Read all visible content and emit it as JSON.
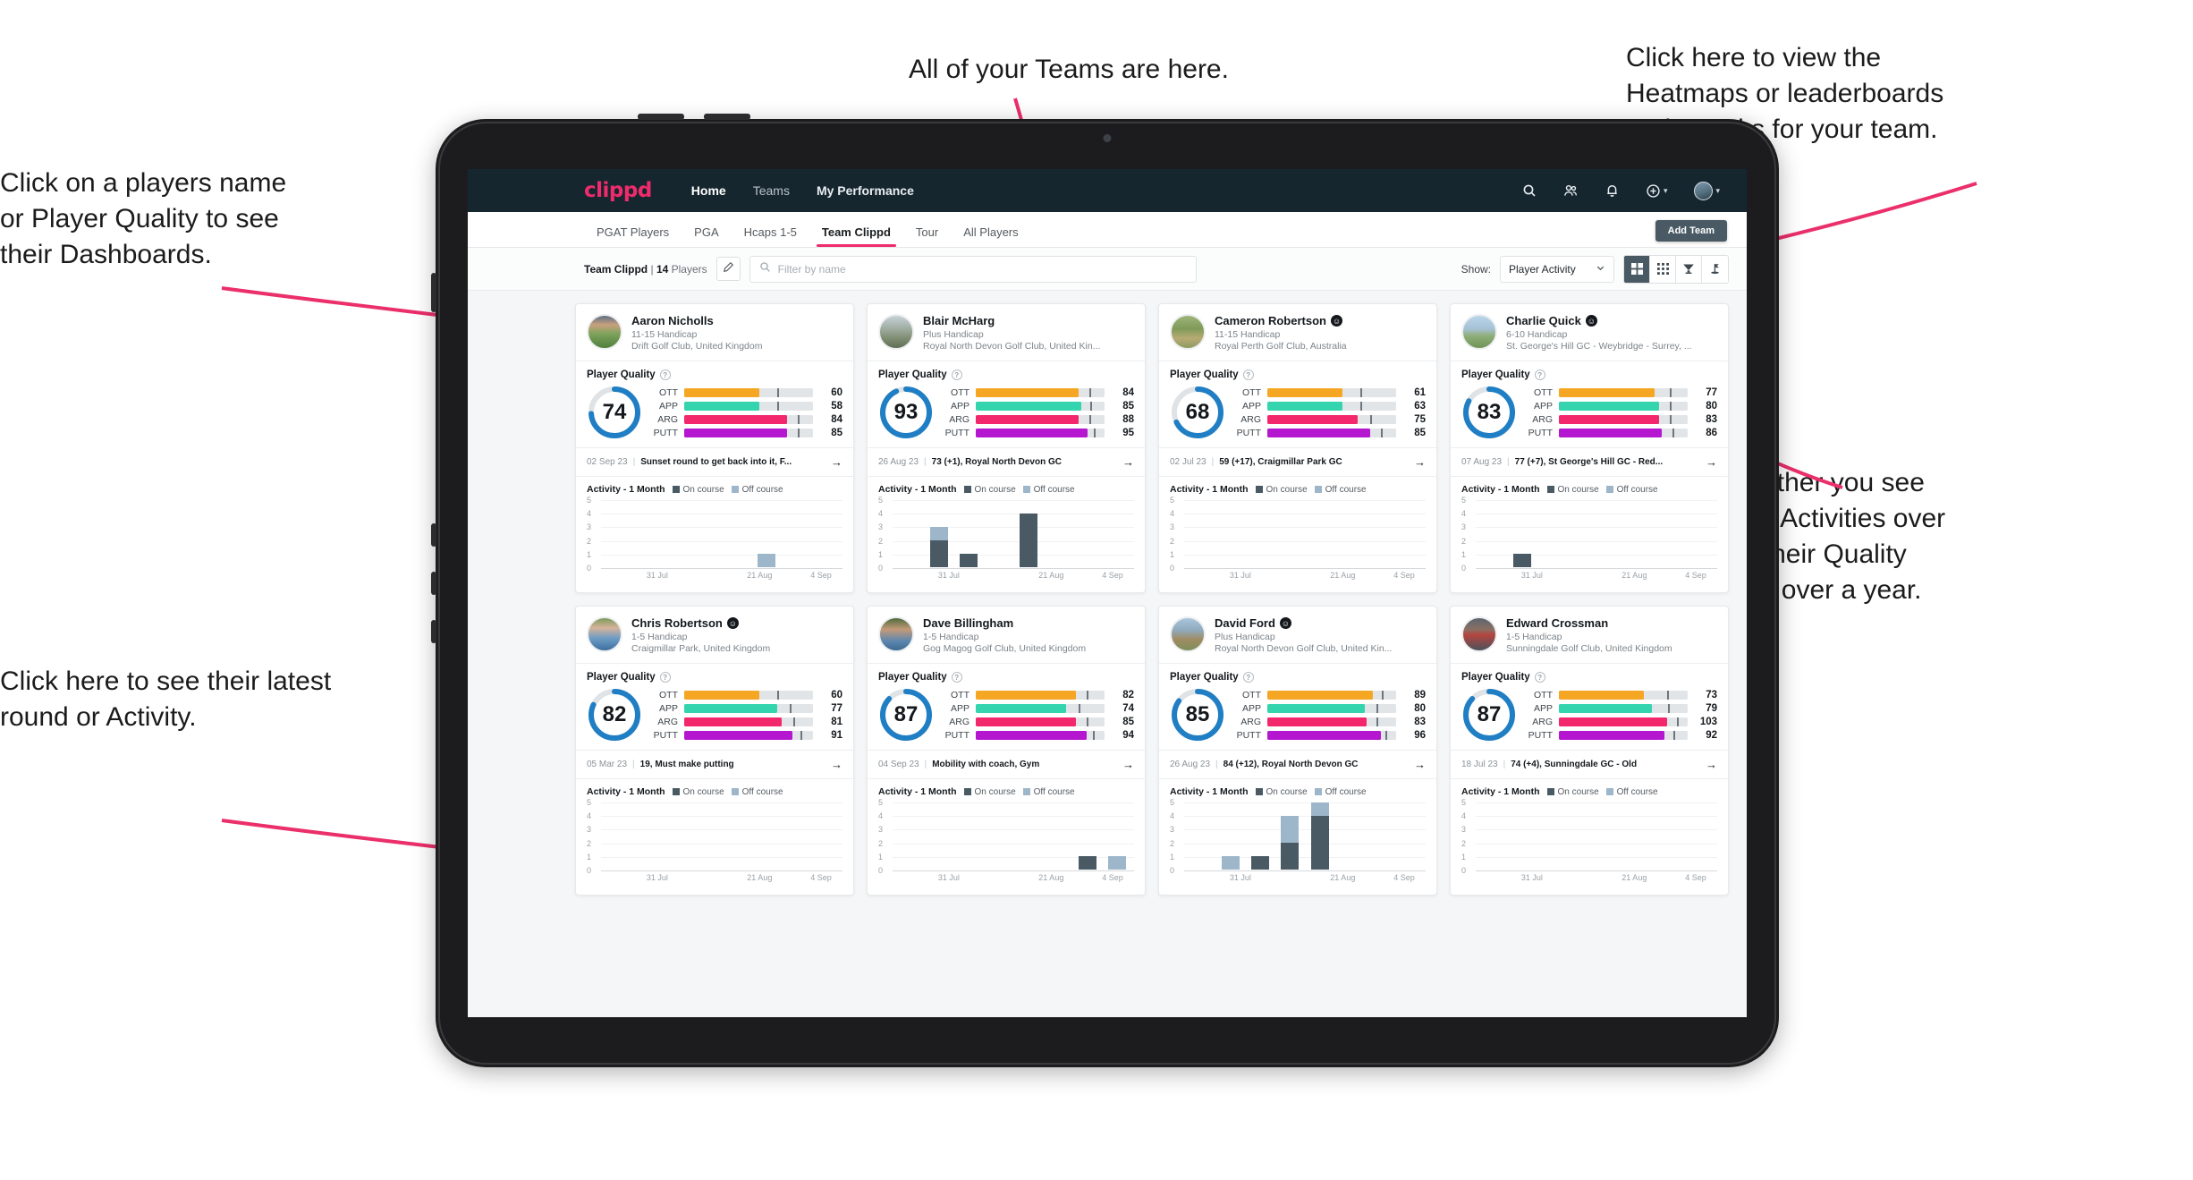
{
  "annotations": [
    {
      "id": "teams",
      "text": "All of your Teams are here."
    },
    {
      "id": "heatmaps",
      "text": "Click here to view the\nHeatmaps or leaderboards\nand streaks for your team."
    },
    {
      "id": "dashboards",
      "text": "Click on a players name\nor Player Quality to see\ntheir Dashboards."
    },
    {
      "id": "activity-toggle",
      "text": "Choose whether you see\nyour players Activities over\na month or their Quality\nScore Trend over a year."
    },
    {
      "id": "latest-round",
      "text": "Click here to see their latest\nround or Activity."
    }
  ],
  "navbar": {
    "brand": "clippd",
    "links": [
      {
        "label": "Home",
        "active": true
      },
      {
        "label": "Teams",
        "active": false
      },
      {
        "label": "My Performance",
        "active": false
      }
    ],
    "icons": [
      "search-icon",
      "people-icon",
      "bell-icon",
      "plus-circle-icon",
      "avatar"
    ]
  },
  "tabs": [
    {
      "label": "PGAT Players",
      "active": false
    },
    {
      "label": "PGA",
      "active": false
    },
    {
      "label": "Hcaps 1-5",
      "active": false
    },
    {
      "label": "Team Clippd",
      "active": true
    },
    {
      "label": "Tour",
      "active": false
    },
    {
      "label": "All Players",
      "active": false
    }
  ],
  "add_team_label": "Add Team",
  "filterbar": {
    "team_name": "Team Clippd",
    "separator": "|",
    "player_count": "14",
    "players_word": "Players",
    "edit_icon": "pencil-icon",
    "search_placeholder": "Filter by name",
    "show_label": "Show:",
    "show_value": "Player Activity",
    "views": [
      {
        "name": "grid-large-view",
        "active": true
      },
      {
        "name": "grid-small-view",
        "active": false
      },
      {
        "name": "trophy-leaderboard-view",
        "active": false
      },
      {
        "name": "flag-course-view",
        "active": false
      }
    ]
  },
  "labels": {
    "player_quality": "Player Quality",
    "activity_title": "Activity - 1 Month",
    "legend_on": "On course",
    "legend_off": "Off course",
    "verified_badge": "☺"
  },
  "colors": {
    "brand_pink": "#ef2b6b",
    "navbar": "#16262f",
    "ring": "#1f7ec4",
    "ott": "#f5a623",
    "app": "#34d5ae",
    "arg": "#f2276c",
    "putt": "#b516cf",
    "on_course": "#4a5a64",
    "off_course": "#9db6ca"
  },
  "chart_data": {
    "type": "bar",
    "title": "Activity - 1 Month",
    "xlabel": "",
    "ylabel": "",
    "ylim": [
      0,
      5
    ],
    "yticks": [
      5,
      4,
      3,
      2,
      1,
      0
    ],
    "xticks": [
      "31 Jul",
      "21 Aug",
      "4 Sep"
    ],
    "legend": [
      "On course",
      "Off course"
    ],
    "legend_position": "top",
    "grid": true,
    "charts": [
      {
        "player": "Aaron Nicholls",
        "on_course": [
          0,
          0,
          0,
          0,
          0,
          0,
          0,
          0
        ],
        "off_course": [
          0,
          0,
          0,
          0,
          0,
          1,
          0,
          0
        ]
      },
      {
        "player": "Blair McHarg",
        "on_course": [
          0,
          2,
          1,
          0,
          4,
          0,
          0,
          0
        ],
        "off_course": [
          0,
          1,
          0,
          0,
          0,
          0,
          0,
          0
        ]
      },
      {
        "player": "Cameron Robertson",
        "on_course": [
          0,
          0,
          0,
          0,
          0,
          0,
          0,
          0
        ],
        "off_course": [
          0,
          0,
          0,
          0,
          0,
          0,
          0,
          0
        ]
      },
      {
        "player": "Charlie Quick",
        "on_course": [
          0,
          1,
          0,
          0,
          0,
          0,
          0,
          0
        ],
        "off_course": [
          0,
          0,
          0,
          0,
          0,
          0,
          0,
          0
        ]
      },
      {
        "player": "Chris Robertson",
        "on_course": [
          0,
          0,
          0,
          0,
          0,
          0,
          0,
          0
        ],
        "off_course": [
          0,
          0,
          0,
          0,
          0,
          0,
          0,
          0
        ]
      },
      {
        "player": "Dave Billingham",
        "on_course": [
          0,
          0,
          0,
          0,
          0,
          0,
          1,
          0
        ],
        "off_course": [
          0,
          0,
          0,
          0,
          0,
          0,
          0,
          1
        ]
      },
      {
        "player": "David Ford",
        "on_course": [
          0,
          0,
          1,
          2,
          4,
          0,
          0,
          0
        ],
        "off_course": [
          0,
          1,
          0,
          2,
          1,
          0,
          0,
          0
        ]
      },
      {
        "player": "Edward Crossman",
        "on_course": [
          0,
          0,
          0,
          0,
          0,
          0,
          0,
          0
        ],
        "off_course": [
          0,
          0,
          0,
          0,
          0,
          0,
          0,
          0
        ]
      }
    ]
  },
  "players": [
    {
      "name": "Aaron Nicholls",
      "verified": false,
      "handicap": "11-15 Handicap",
      "club": "Drift Golf Club, United Kingdom",
      "quality": 74,
      "metrics": [
        {
          "label": "OTT",
          "value": 60,
          "fill": 58,
          "tick": 72
        },
        {
          "label": "APP",
          "value": 58,
          "fill": 58,
          "tick": 72
        },
        {
          "label": "ARG",
          "value": 84,
          "fill": 80,
          "tick": 88
        },
        {
          "label": "PUTT",
          "value": 85,
          "fill": 80,
          "tick": 88
        }
      ],
      "round_date": "02 Sep 23",
      "round_text": "Sunset round to get back into it, F...",
      "avatar_css": "linear-gradient(180deg,#5d6f86 0%,#c9a07e 28%,#7fa35c 55%,#4f7f3d 100%)"
    },
    {
      "name": "Blair McHarg",
      "verified": false,
      "handicap": "Plus Handicap",
      "club": "Royal North Devon Golf Club, United Kin...",
      "quality": 93,
      "metrics": [
        {
          "label": "OTT",
          "value": 84,
          "fill": 80,
          "tick": 88
        },
        {
          "label": "APP",
          "value": 85,
          "fill": 82,
          "tick": 89
        },
        {
          "label": "ARG",
          "value": 88,
          "fill": 80,
          "tick": 88
        },
        {
          "label": "PUTT",
          "value": 95,
          "fill": 87,
          "tick": 92
        }
      ],
      "round_date": "26 Aug 23",
      "round_text": "73 (+1), Royal North Devon GC",
      "avatar_css": "linear-gradient(180deg,#c7d2d8 0%,#9aa89a 45%,#7f8d72 70%,#5f6d55 100%)"
    },
    {
      "name": "Cameron Robertson",
      "verified": true,
      "handicap": "11-15 Handicap",
      "club": "Royal Perth Golf Club, Australia",
      "quality": 68,
      "metrics": [
        {
          "label": "OTT",
          "value": 61,
          "fill": 58,
          "tick": 72
        },
        {
          "label": "APP",
          "value": 63,
          "fill": 58,
          "tick": 72
        },
        {
          "label": "ARG",
          "value": 75,
          "fill": 70,
          "tick": 80
        },
        {
          "label": "PUTT",
          "value": 85,
          "fill": 80,
          "tick": 88
        }
      ],
      "round_date": "02 Jul 23",
      "round_text": "59 (+17), Craigmillar Park GC",
      "avatar_css": "linear-gradient(180deg,#9db57b 0%,#7f9a58 40%,#b7ab74 70%,#8e9a63 100%)"
    },
    {
      "name": "Charlie Quick",
      "verified": true,
      "handicap": "6-10 Handicap",
      "club": "St. George's Hill GC - Weybridge - Surrey, ...",
      "quality": 83,
      "metrics": [
        {
          "label": "OTT",
          "value": 77,
          "fill": 74,
          "tick": 86
        },
        {
          "label": "APP",
          "value": 80,
          "fill": 78,
          "tick": 86
        },
        {
          "label": "ARG",
          "value": 83,
          "fill": 78,
          "tick": 86
        },
        {
          "label": "PUTT",
          "value": 86,
          "fill": 80,
          "tick": 88
        }
      ],
      "round_date": "07 Aug 23",
      "round_text": "77 (+7), St George's Hill GC - Red...",
      "avatar_css": "linear-gradient(180deg,#b9d5ea 0%,#a7c2d6 40%,#8fae79 62%,#6f9456 100%)"
    },
    {
      "name": "Chris Robertson",
      "verified": true,
      "handicap": "1-5 Handicap",
      "club": "Craigmillar Park, United Kingdom",
      "quality": 82,
      "metrics": [
        {
          "label": "OTT",
          "value": 60,
          "fill": 58,
          "tick": 72
        },
        {
          "label": "APP",
          "value": 77,
          "fill": 72,
          "tick": 82
        },
        {
          "label": "ARG",
          "value": 81,
          "fill": 76,
          "tick": 85
        },
        {
          "label": "PUTT",
          "value": 91,
          "fill": 84,
          "tick": 90
        }
      ],
      "round_date": "05 Mar 23",
      "round_text": "19, Must make putting",
      "avatar_css": "linear-gradient(180deg,#7c9a5c 0%,#d7b49a 30%,#6e9cc4 62%,#3d6f9e 100%)"
    },
    {
      "name": "Dave Billingham",
      "verified": false,
      "handicap": "1-5 Handicap",
      "club": "Gog Magog Golf Club, United Kingdom",
      "quality": 87,
      "metrics": [
        {
          "label": "OTT",
          "value": 82,
          "fill": 78,
          "tick": 86
        },
        {
          "label": "APP",
          "value": 74,
          "fill": 70,
          "tick": 80
        },
        {
          "label": "ARG",
          "value": 85,
          "fill": 78,
          "tick": 86
        },
        {
          "label": "PUTT",
          "value": 94,
          "fill": 86,
          "tick": 91
        }
      ],
      "round_date": "04 Sep 23",
      "round_text": "Mobility with coach, Gym",
      "avatar_css": "linear-gradient(180deg,#4e6b3c 0%,#c49a78 35%,#5e87ae 70%,#3d6a92 100%)"
    },
    {
      "name": "David Ford",
      "verified": true,
      "handicap": "Plus Handicap",
      "club": "Royal North Devon Golf Club, United Kin...",
      "quality": 85,
      "metrics": [
        {
          "label": "OTT",
          "value": 89,
          "fill": 82,
          "tick": 89
        },
        {
          "label": "APP",
          "value": 80,
          "fill": 76,
          "tick": 85
        },
        {
          "label": "ARG",
          "value": 83,
          "fill": 77,
          "tick": 85
        },
        {
          "label": "PUTT",
          "value": 96,
          "fill": 88,
          "tick": 92
        }
      ],
      "round_date": "26 Aug 23",
      "round_text": "84 (+12), Royal North Devon GC",
      "avatar_css": "linear-gradient(180deg,#a9c6de 0%,#8fa9bb 38%,#a08b62 66%,#7d8f5c 100%)"
    },
    {
      "name": "Edward Crossman",
      "verified": false,
      "handicap": "1-5 Handicap",
      "club": "Sunningdale Golf Club, United Kingdom",
      "quality": 87,
      "metrics": [
        {
          "label": "OTT",
          "value": 73,
          "fill": 66,
          "tick": 84
        },
        {
          "label": "APP",
          "value": 79,
          "fill": 72,
          "tick": 85
        },
        {
          "label": "ARG",
          "value": 103,
          "fill": 84,
          "tick": 92
        },
        {
          "label": "PUTT",
          "value": 92,
          "fill": 82,
          "tick": 89
        }
      ],
      "round_date": "18 Jul 23",
      "round_text": "74 (+4), Sunningdale GC - Old",
      "avatar_css": "linear-gradient(180deg,#5e6570 0%,#8a6f63 35%,#b4453f 52%,#4a525c 100%)"
    }
  ]
}
